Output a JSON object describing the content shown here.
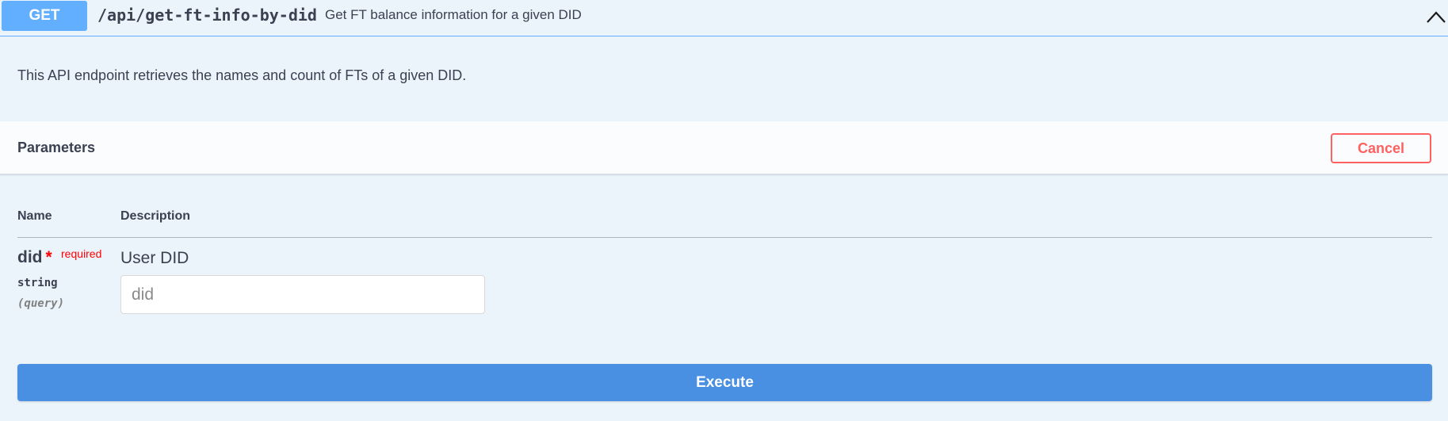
{
  "operation": {
    "method": "GET",
    "path": "/api/get-ft-info-by-did",
    "summary": "Get FT balance information for a given DID",
    "description": "This API endpoint retrieves the names and count of FTs of a given DID.",
    "collapse_icon": "chevron-up-icon",
    "method_color": "#61affe"
  },
  "parameters": {
    "title": "Parameters",
    "cancel_label": "Cancel",
    "columns": {
      "name": "Name",
      "description": "Description"
    },
    "items": [
      {
        "name": "did",
        "required_star": "*",
        "required_label": "required",
        "type": "string",
        "in": "(query)",
        "description": "User DID",
        "input_value": "",
        "placeholder": "did"
      }
    ]
  },
  "execute_label": "Execute",
  "colors": {
    "background": "#ebf3fb",
    "accent": "#4990e2",
    "danger": "#ff6060"
  }
}
